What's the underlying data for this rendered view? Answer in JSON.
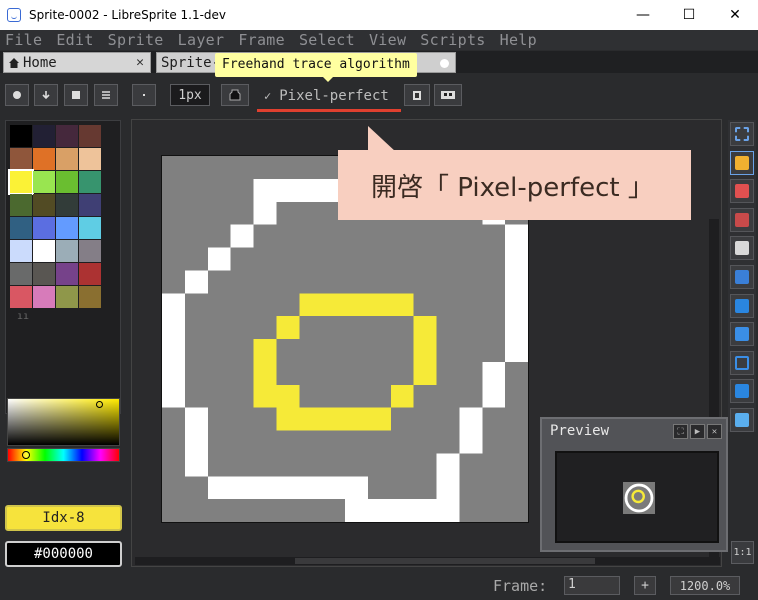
{
  "window": {
    "title": "Sprite-0002 - LibreSprite 1.1-dev",
    "minimize": "—",
    "maximize": "☐",
    "close": "✕"
  },
  "menu": [
    "File",
    "Edit",
    "Sprite",
    "Layer",
    "Frame",
    "Select",
    "View",
    "Scripts",
    "Help"
  ],
  "tabs": {
    "home": "Home",
    "home_close": "✕",
    "sprite": "Sprite-"
  },
  "tooltip": "Freehand trace algorithm",
  "context_bar": {
    "brush_size": "1px",
    "pixel_perfect_label": "Pixel-perfect",
    "pixel_perfect_checked": true,
    "check_glyph": "✓"
  },
  "callout": "開啓「 Pixel-perfect 」",
  "palette": {
    "colors": [
      "#000000",
      "#222034",
      "#45283c",
      "#663931",
      "#8f563b",
      "#df7126",
      "#d9a066",
      "#eec39a",
      "#fbf236",
      "#99e550",
      "#6abe30",
      "#37946e",
      "#4b692f",
      "#524b24",
      "#323c39",
      "#3f3f74",
      "#306082",
      "#5b6ee1",
      "#639bff",
      "#5fcde4",
      "#cbdbfc",
      "#ffffff",
      "#9badb7",
      "#847e87",
      "#696a6a",
      "#595652",
      "#76428a",
      "#ac3232",
      "#d95763",
      "#d77bba",
      "#8f974a",
      "#8a6f30"
    ],
    "handle": "ıı"
  },
  "colors": {
    "foreground_label": "Idx-8",
    "foreground_color": "#fbf236",
    "background_label": "#000000"
  },
  "canvas": {
    "grid_size": 16,
    "gray": "#808080",
    "white": "#ffffff",
    "yellow": "#f6ea38"
  },
  "preview": {
    "title": "Preview"
  },
  "tools": [
    "marquee-icon",
    "pencil-icon",
    "eraser-icon",
    "eyedropper-icon",
    "zoom-icon",
    "move-icon",
    "fill-icon",
    "line-icon",
    "rectangle-icon",
    "spray-icon",
    "contour-icon"
  ],
  "zoom_button": "1:1",
  "status": {
    "frame_label": "Frame:",
    "frame_value": "1",
    "add_frame": "+",
    "zoom": "1200.0%"
  }
}
